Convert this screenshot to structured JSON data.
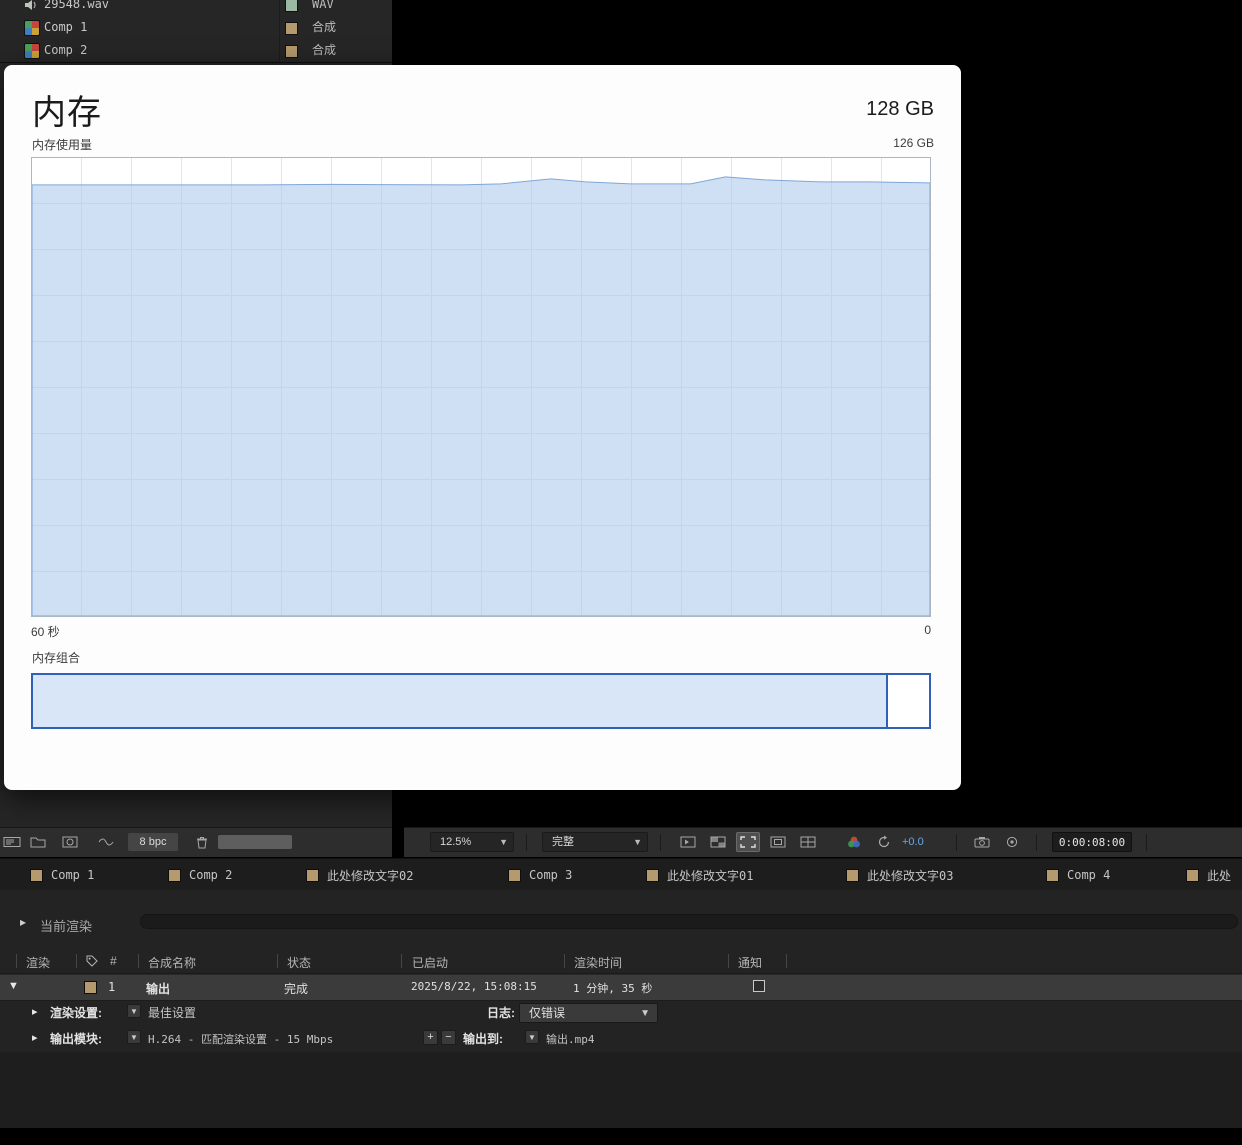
{
  "project_panel": {
    "items": [
      {
        "name": "29548.wav",
        "type": "WAV"
      },
      {
        "name": "Comp 1",
        "type": "合成"
      },
      {
        "name": "Comp 2",
        "type": "合成"
      }
    ]
  },
  "memory_dialog": {
    "title": "内存",
    "total": "128 GB",
    "usage_label": "内存使用量",
    "usage_peak": "126 GB",
    "axis_left": "60 秒",
    "axis_right": "0",
    "pool_label": "内存组合",
    "usage_fill_percent": 95,
    "pool_fill_percent": 95.2
  },
  "left_toolbar": {
    "bpc": "8 bpc"
  },
  "viewer_toolbar": {
    "zoom": "12.5%",
    "resolution": "完整",
    "exposure": "+0.0",
    "timecode": "0:00:08:00"
  },
  "comp_tabs": [
    "Comp 1",
    "Comp 2",
    "此处修改文字02",
    "Comp 3",
    "此处修改文字01",
    "此处修改文字03",
    "Comp 4",
    "此处"
  ],
  "render_queue": {
    "current_label": "当前渲染",
    "headers": {
      "render": "渲染",
      "number": "#",
      "comp_name": "合成名称",
      "status": "状态",
      "started": "已启动",
      "render_time": "渲染时间",
      "notify": "通知"
    },
    "job": {
      "number": "1",
      "name": "输出",
      "status": "完成",
      "started": "2025/8/22, 15:08:15",
      "render_time": "1 分钟, 35 秒"
    },
    "render_settings_label": "渲染设置:",
    "render_settings_value": "最佳设置",
    "log_label": "日志:",
    "log_value": "仅错误",
    "output_module_label": "输出模块:",
    "output_module_value": "H.264 - 匹配渲染设置 - 15 Mbps",
    "output_to_label": "输出到:",
    "output_to_value": "输出.mp4",
    "add_label": "+",
    "remove_label": "−"
  }
}
